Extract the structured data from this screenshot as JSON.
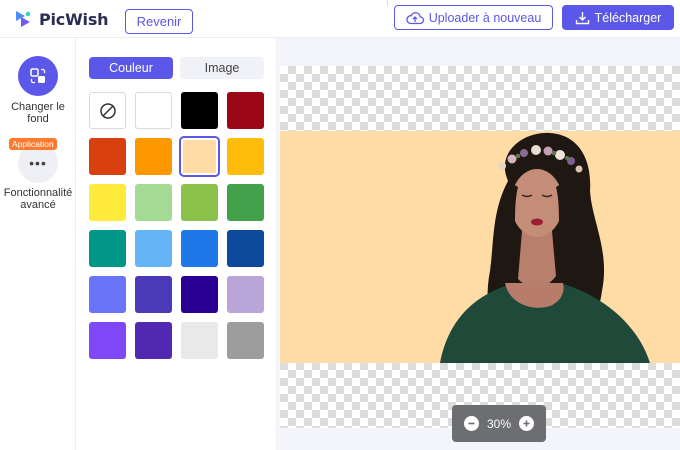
{
  "header": {
    "brand": "PicWish",
    "back_label": "Revenir",
    "upload_label": "Uploader à nouveau",
    "download_label": "Télécharger"
  },
  "rail": {
    "items": [
      {
        "label": "Changer le fond",
        "icon": "swap-background-icon",
        "active": true
      },
      {
        "label": "Fonctionnalité avancé",
        "icon": "more-dots-icon",
        "badge": "Application",
        "dots": "•••"
      }
    ]
  },
  "panel": {
    "tabs": [
      {
        "label": "Couleur",
        "active": true
      },
      {
        "label": "Image",
        "active": false
      }
    ],
    "swatches": [
      {
        "name": "none",
        "color": "none"
      },
      {
        "name": "white",
        "color": "#ffffff"
      },
      {
        "name": "black",
        "color": "#000000"
      },
      {
        "name": "dark-red",
        "color": "#9b0717"
      },
      {
        "name": "red-orange",
        "color": "#d8410f"
      },
      {
        "name": "orange",
        "color": "#ff9800"
      },
      {
        "name": "peach",
        "color": "#ffdba6",
        "selected": true
      },
      {
        "name": "amber",
        "color": "#ffbc0a"
      },
      {
        "name": "yellow",
        "color": "#ffeb3b"
      },
      {
        "name": "light-green",
        "color": "#a5da95"
      },
      {
        "name": "green",
        "color": "#8bc34a"
      },
      {
        "name": "dark-green",
        "color": "#43a04b"
      },
      {
        "name": "teal",
        "color": "#009688"
      },
      {
        "name": "sky-blue",
        "color": "#64b4f6"
      },
      {
        "name": "blue",
        "color": "#1f78e8"
      },
      {
        "name": "navy",
        "color": "#0d4a9c"
      },
      {
        "name": "periwinkle",
        "color": "#6a74f8"
      },
      {
        "name": "indigo",
        "color": "#4a3ab8"
      },
      {
        "name": "deep-indigo",
        "color": "#2a0094"
      },
      {
        "name": "lavender",
        "color": "#b9a5d7"
      },
      {
        "name": "violet",
        "color": "#8047f6"
      },
      {
        "name": "purple",
        "color": "#5128b2"
      },
      {
        "name": "light-gray",
        "color": "#e9e9e9"
      },
      {
        "name": "gray",
        "color": "#9d9d9d"
      }
    ]
  },
  "canvas": {
    "background_color": "#ffdba6",
    "zoom_label": "30%"
  },
  "colors": {
    "accent": "#5b57e8",
    "badge": "#ff7a2e"
  }
}
